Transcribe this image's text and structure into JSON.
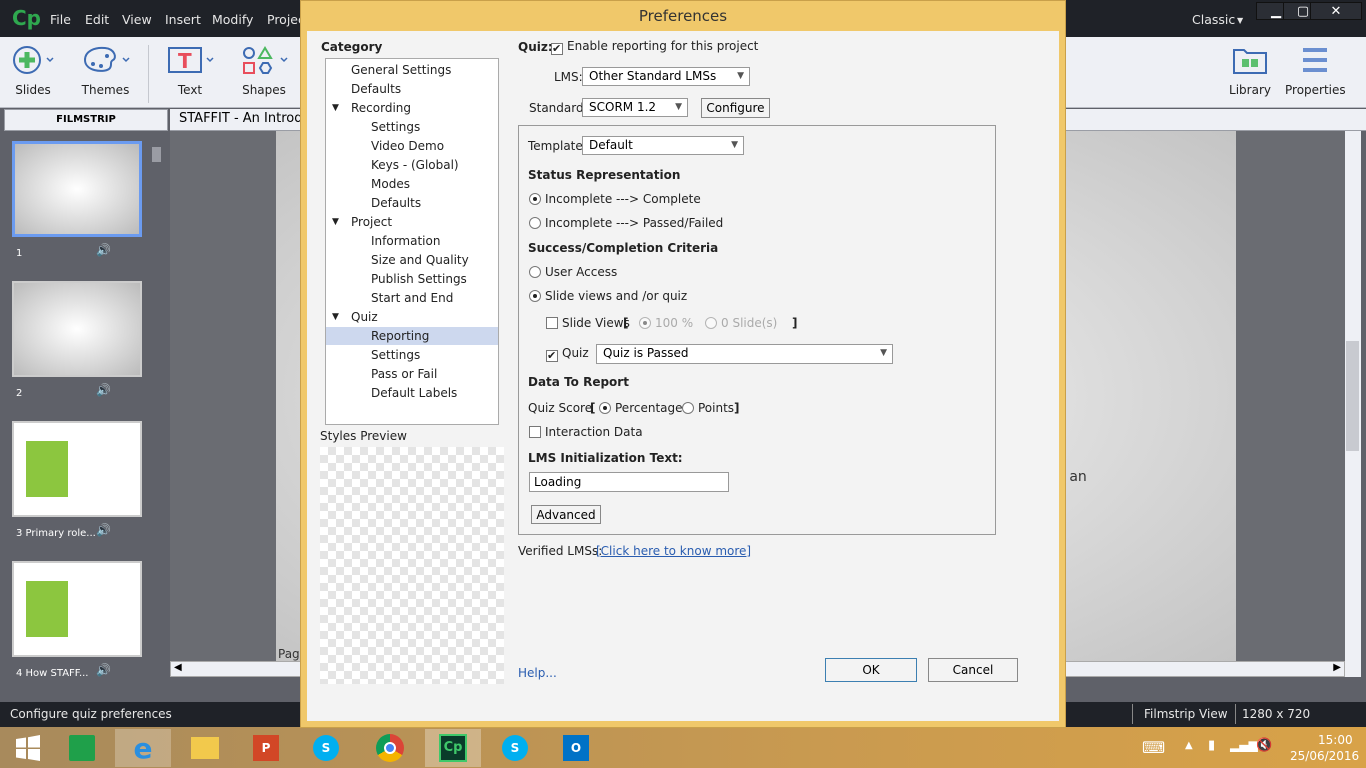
{
  "app": {
    "logo": "Cp",
    "menu": [
      "File",
      "Edit",
      "View",
      "Insert",
      "Modify",
      "Projec"
    ],
    "workspace": "Classic",
    "window_controls": [
      "minimize",
      "maximize",
      "close"
    ]
  },
  "toolbar": {
    "left": [
      {
        "label": "Slides",
        "icon": "add-slide-icon"
      },
      {
        "label": "Themes",
        "icon": "palette-icon"
      },
      {
        "label": "Text",
        "icon": "text-caption-icon"
      },
      {
        "label": "Shapes",
        "icon": "shapes-icon"
      }
    ],
    "right": [
      {
        "label": "Library",
        "icon": "library-icon"
      },
      {
        "label": "Properties",
        "icon": "properties-icon"
      }
    ]
  },
  "filmstrip": {
    "header": "FILMSTRIP",
    "slides": [
      {
        "num": "1"
      },
      {
        "num": "2"
      },
      {
        "num": "3 Primary role..."
      },
      {
        "num": "4 How STAFF..."
      }
    ],
    "selected": 0
  },
  "document": {
    "tab": "STAFFIT - An Introdu",
    "slide_text_fragment": "g an",
    "page_fragment": "Pag"
  },
  "statusbar": {
    "message": "Configure quiz preferences",
    "view": "Filmstrip View",
    "resolution": "1280 x 720"
  },
  "taskbar": {
    "apps": [
      "start",
      "store",
      "internet-explorer",
      "file-explorer",
      "powerpoint",
      "skype",
      "chrome",
      "captivate",
      "skype-business",
      "outlook"
    ],
    "time": "15:00",
    "date": "25/06/2016"
  },
  "dialog": {
    "title": "Preferences",
    "category_label": "Category",
    "categories": [
      {
        "label": "General Settings",
        "level": 0
      },
      {
        "label": "Defaults",
        "level": 0
      },
      {
        "label": "Recording",
        "level": 0,
        "expanded": true
      },
      {
        "label": "Settings",
        "level": 1
      },
      {
        "label": "Video Demo",
        "level": 1
      },
      {
        "label": "Keys - (Global)",
        "level": 1
      },
      {
        "label": "Modes",
        "level": 1
      },
      {
        "label": "Defaults",
        "level": 1
      },
      {
        "label": "Project",
        "level": 0,
        "expanded": true
      },
      {
        "label": "Information",
        "level": 1
      },
      {
        "label": "Size and Quality",
        "level": 1
      },
      {
        "label": "Publish Settings",
        "level": 1
      },
      {
        "label": "Start and End",
        "level": 1
      },
      {
        "label": "Quiz",
        "level": 0,
        "expanded": true
      },
      {
        "label": "Reporting",
        "level": 1,
        "selected": true
      },
      {
        "label": "Settings",
        "level": 1
      },
      {
        "label": "Pass or Fail",
        "level": 1
      },
      {
        "label": "Default Labels",
        "level": 1
      }
    ],
    "styles_preview_label": "Styles Preview",
    "quiz_label": "Quiz:",
    "enable_reporting": {
      "label": "Enable reporting for this project",
      "checked": true
    },
    "lms": {
      "label": "LMS:",
      "value": "Other Standard LMSs"
    },
    "standard": {
      "label": "Standard:",
      "value": "SCORM 1.2"
    },
    "configure_button": "Configure",
    "template": {
      "label": "Template:",
      "value": "Default"
    },
    "status_representation": {
      "heading": "Status Representation",
      "options": [
        "Incomplete ---> Complete",
        "Incomplete ---> Passed/Failed"
      ],
      "selected": 0
    },
    "criteria": {
      "heading": "Success/Completion Criteria",
      "options": [
        "User Access",
        "Slide views and /or quiz"
      ],
      "selected": 1,
      "slide_views": {
        "label": "Slide Views",
        "checked": false,
        "bracket_open": "[",
        "bracket_close": "]",
        "percent": "100 %",
        "slides": "0 Slide(s)",
        "selected": 0
      },
      "quiz": {
        "label": "Quiz",
        "checked": true,
        "value": "Quiz is Passed"
      }
    },
    "data_to_report": {
      "heading": "Data To Report",
      "quiz_score_label": "Quiz Score",
      "bracket_open": "[",
      "bracket_close": "]",
      "options": [
        "Percentage",
        "Points"
      ],
      "selected": 0,
      "interaction_data": {
        "label": "Interaction Data",
        "checked": false
      }
    },
    "lms_init": {
      "heading": "LMS Initialization Text:",
      "value": "Loading"
    },
    "advanced_button": "Advanced",
    "verified_lms": {
      "label": "Verified LMSs:",
      "link": "[Click here to know more]"
    },
    "help_link": "Help...",
    "ok_button": "OK",
    "cancel_button": "Cancel"
  }
}
